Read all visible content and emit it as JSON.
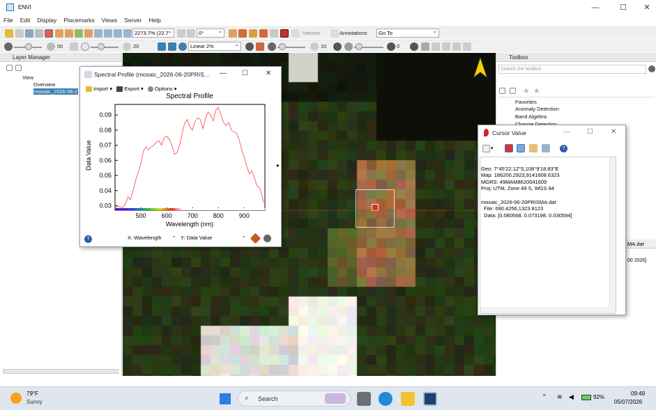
{
  "app": {
    "title": "ENVI",
    "win_minimize": "—",
    "win_maximize": "☐",
    "win_close": "✕"
  },
  "menu": [
    "File",
    "Edit",
    "Display",
    "Placemarks",
    "Views",
    "Server",
    "Help"
  ],
  "toolbar1": {
    "zoom": "2273.7% (22.7",
    "rotation": "0°",
    "vectors": "Vectors",
    "annotations": "Annotations",
    "goto": "Go To"
  },
  "toolbar2": {
    "brightness": "50",
    "contrast": "20",
    "stretch": "Linear 2%",
    "sharpen": "10",
    "transparency": "0"
  },
  "layer_manager": {
    "title": "Layer Manager",
    "tree": [
      "View",
      "Overview",
      "mosaic_2026-06-2"
    ]
  },
  "toolbox": {
    "title": "Toolbox",
    "search_placeholder": "Search the toolbox",
    "items": [
      "Favorites",
      "Anomaly Detection",
      "Band Algebra",
      "Change Detection"
    ]
  },
  "background_fragments": {
    "a": "MA.dat",
    "b": "00 2026]"
  },
  "spectral": {
    "title": "Spectral Profile (mosaic_2026-06-20PRIS...",
    "menu": [
      "Import",
      "Export",
      "Options"
    ],
    "x_selector": "X: Wavelength",
    "y_selector": "Y: Data Value"
  },
  "chart_data": {
    "type": "line",
    "title": "Spectral Profile",
    "xlabel": "Wavelength (nm)",
    "ylabel": "Data Value",
    "xlim": [
      400,
      980
    ],
    "ylim": [
      0.027,
      0.097
    ],
    "xticks": [
      500,
      600,
      700,
      800,
      900
    ],
    "yticks": [
      0.03,
      0.04,
      0.05,
      0.06,
      0.07,
      0.08,
      0.09
    ],
    "series": [
      {
        "color": "#ff4040",
        "x": [
          402,
          410,
          420,
          430,
          440,
          450,
          460,
          470,
          480,
          490,
          500,
          510,
          520,
          530,
          540,
          550,
          560,
          570,
          580,
          590,
          600,
          610,
          620,
          630,
          640,
          650,
          660,
          670,
          680,
          690,
          700,
          710,
          720,
          730,
          740,
          750,
          760,
          770,
          780,
          790,
          800,
          810,
          820,
          830,
          840,
          850,
          860,
          870,
          880,
          890,
          900,
          910,
          920,
          930,
          940,
          950,
          960,
          970,
          975
        ],
        "y": [
          0.028,
          0.03,
          0.029,
          0.029,
          0.031,
          0.036,
          0.034,
          0.04,
          0.047,
          0.052,
          0.058,
          0.066,
          0.069,
          0.067,
          0.069,
          0.07,
          0.072,
          0.073,
          0.07,
          0.075,
          0.076,
          0.074,
          0.07,
          0.064,
          0.065,
          0.07,
          0.078,
          0.085,
          0.087,
          0.082,
          0.08,
          0.086,
          0.088,
          0.087,
          0.081,
          0.088,
          0.092,
          0.09,
          0.086,
          0.093,
          0.095,
          0.09,
          0.085,
          0.083,
          0.085,
          0.08,
          0.079,
          0.078,
          0.074,
          0.067,
          0.062,
          0.056,
          0.051,
          0.053,
          0.048,
          0.043,
          0.042,
          0.036,
          0.032
        ]
      }
    ]
  },
  "cursor_value": {
    "title": "Cursor Value",
    "lines": [
      "Geo: 7°45'22.12\"S,108°9'18.83\"E",
      "Map: 186200.2923,9141608.6323",
      "MGRS: 49MAM8620041609",
      "Proj: UTM, Zone 49 S, WGS 84",
      "",
      "mosaic_2026-06-20PRISMA.dat",
      "  File: 690.4256,1323.8123",
      "  Data: [0.080568, 0.073198, 0.030594]"
    ]
  },
  "taskbar": {
    "temp": "79°F",
    "weather": "Sunny",
    "search": "Search",
    "battery": "92%",
    "time": "09:49",
    "date": "05/07/2026"
  },
  "colors": {
    "accent": "#3c7fb1",
    "plot_line": "#ff4040"
  }
}
